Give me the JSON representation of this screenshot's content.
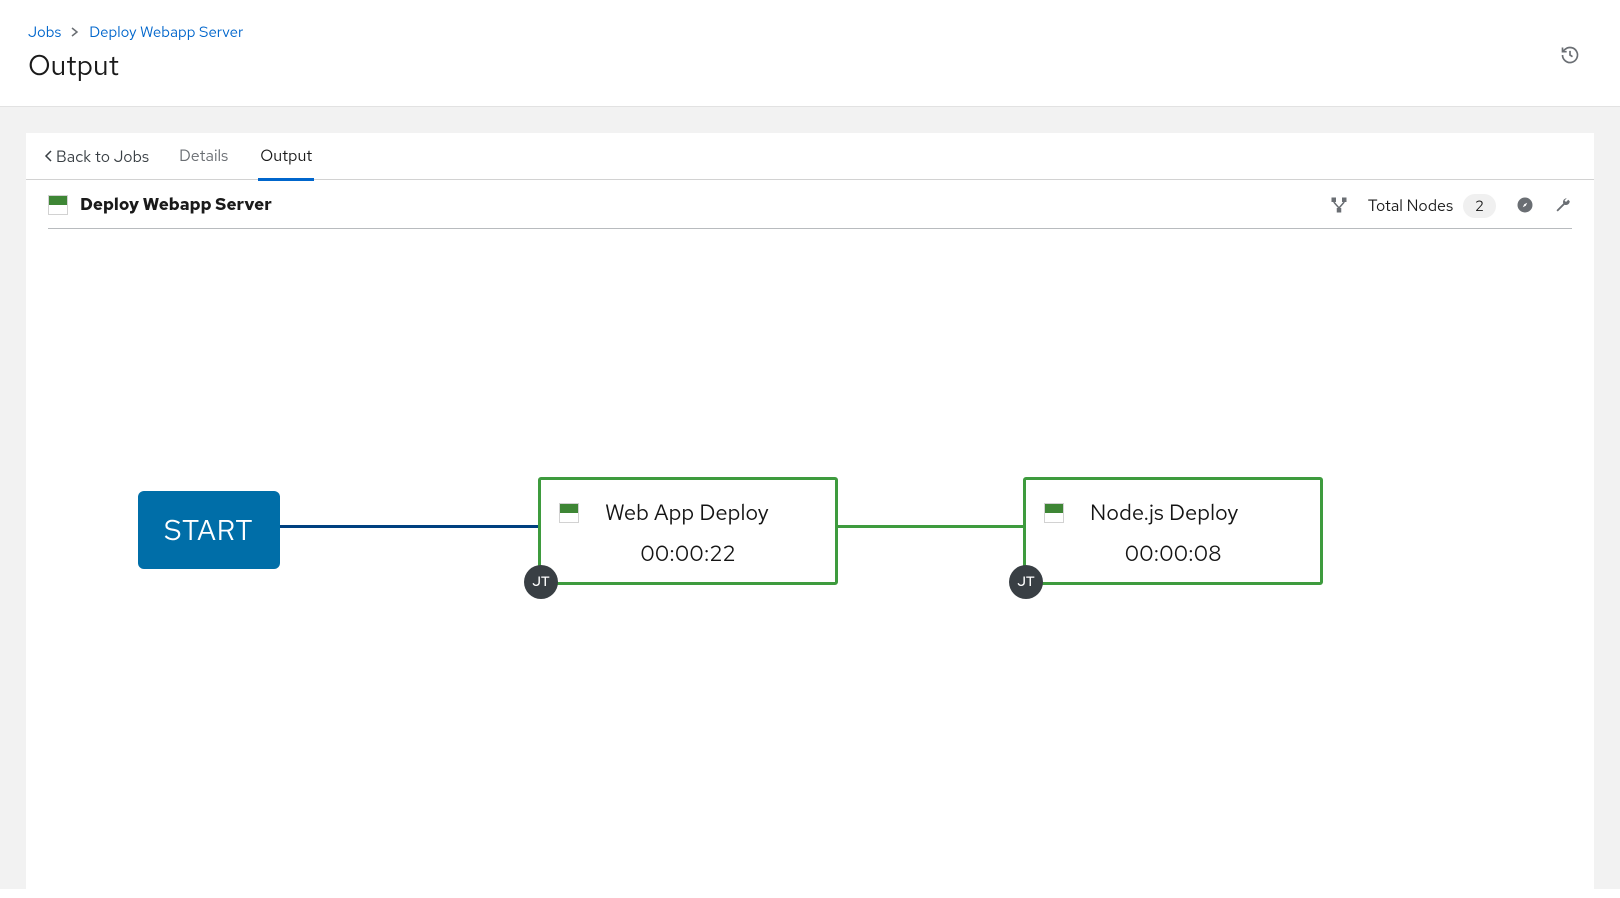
{
  "breadcrumb": {
    "root": "Jobs",
    "current": "Deploy Webapp Server"
  },
  "page_title": "Output",
  "tabs": {
    "back": "Back to Jobs",
    "details": "Details",
    "output": "Output"
  },
  "panel": {
    "title": "Deploy Webapp Server",
    "total_nodes_label": "Total Nodes",
    "total_nodes_count": "2"
  },
  "workflow": {
    "start_label": "START",
    "nodes": [
      {
        "name": "Web App Deploy",
        "elapsed": "00:00:22",
        "type_badge": "JT"
      },
      {
        "name": "Node.js Deploy",
        "elapsed": "00:00:08",
        "type_badge": "JT"
      }
    ]
  }
}
